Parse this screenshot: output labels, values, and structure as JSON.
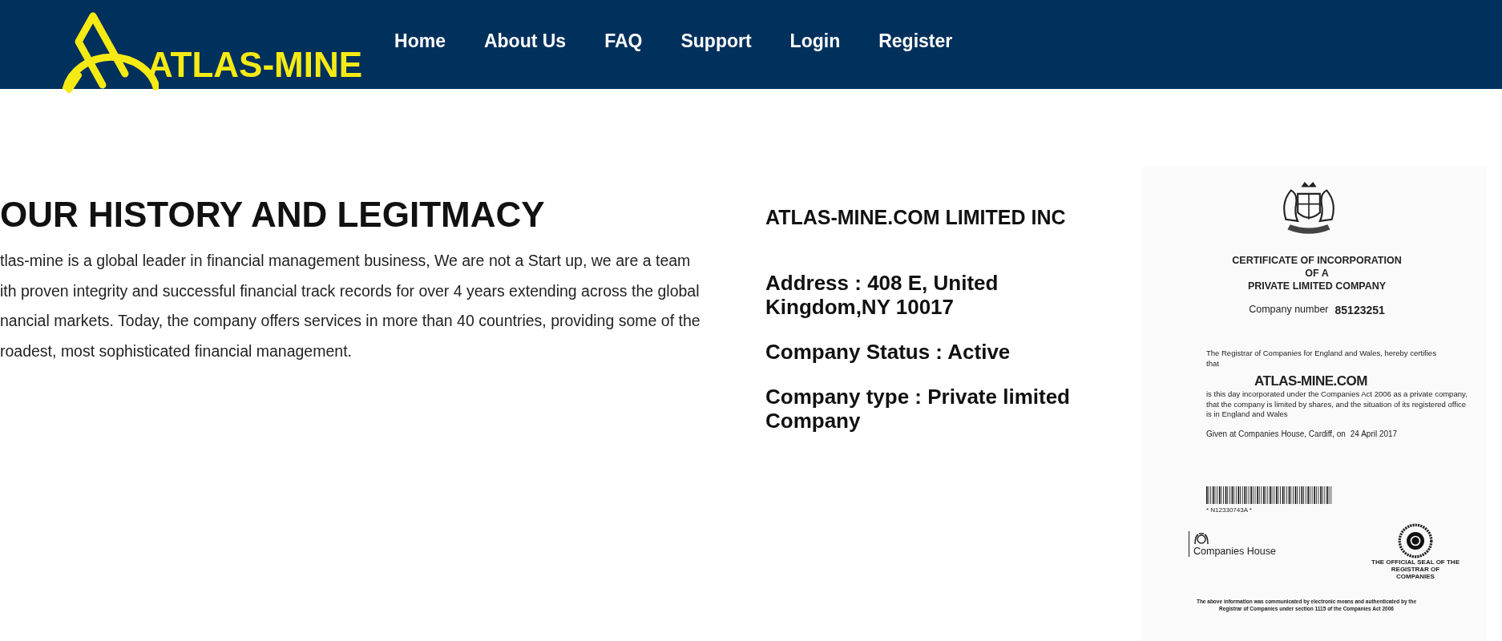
{
  "header": {
    "logo": "ATLAS-MINE",
    "nav": [
      {
        "label": "Home"
      },
      {
        "label": "About Us"
      },
      {
        "label": "FAQ"
      },
      {
        "label": "Support"
      },
      {
        "label": "Login"
      },
      {
        "label": "Register"
      }
    ]
  },
  "history": {
    "title": "OUR HISTORY AND LEGITMACY",
    "lines": [
      "tlas-mine is a global leader in financial management business, We are not a Start up, we are a team",
      "ith proven integrity and successful financial track records for over 4 years extending across the global",
      "nancial markets. Today, the company offers services in more than 40 countries, providing some of the",
      "roadest, most sophisticated financial management."
    ]
  },
  "company": {
    "name": "ATLAS-MINE.COM LIMITED INC",
    "facts": [
      "Address : 408 E, United Kingdom,NY 10017",
      "Company Status : Active",
      "Company type : Private limited Company"
    ]
  },
  "certificate": {
    "title_lines": [
      "CERTIFICATE OF INCORPORATION",
      "OF A",
      "PRIVATE LIMITED COMPANY"
    ],
    "number_label": "Company number",
    "number": "85123251",
    "certifies": "The Registrar of Companies for England and Wales, hereby certifies that",
    "company": "ATLAS-MINE.COM",
    "body": "is this day incorporated under the Companies Act 2006 as a private company, that the company is limited by shares, and the situation of its registered office is in England and Wales",
    "given": "Given at Companies House, Cardiff, on",
    "date": "24 April 2017",
    "barcode_text": "* N12330743A *",
    "house": "Companies House",
    "seal_caption": "THE OFFICIAL SEAL OF THE REGISTRAR OF COMPANIES",
    "footer": "The above information was communicated by electronic means and authenticated by the Registrar of Companies under section 1115 of the Companies Act 2006"
  }
}
